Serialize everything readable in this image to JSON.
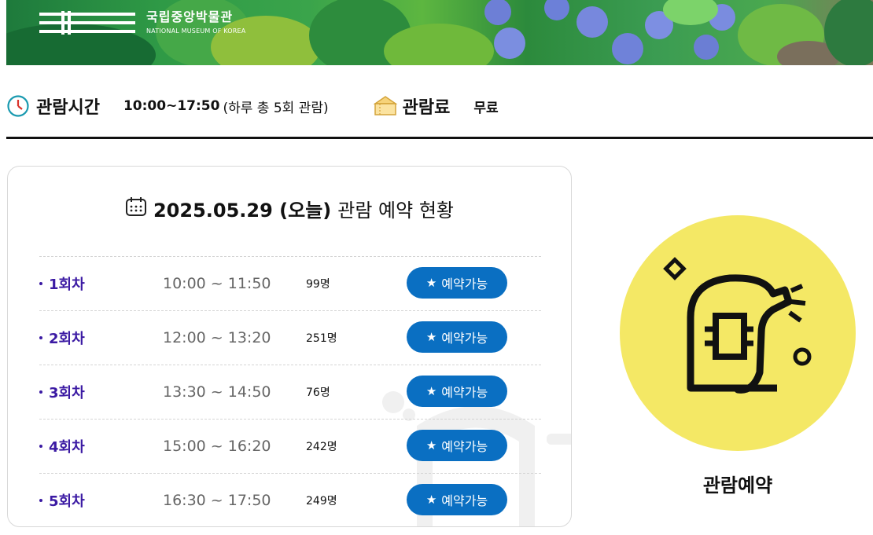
{
  "brand": {
    "name_ko": "국립중앙박물관",
    "name_en": "NATIONAL MUSEUM OF KOREA"
  },
  "info": {
    "hours_label": "관람시간",
    "hours_value": "10:00~17:50",
    "hours_note": "(하루 총 5회 관람)",
    "fee_label": "관람료",
    "fee_value": "무료",
    "hours_icon": "clock-icon",
    "fee_icon": "ticket-icon"
  },
  "status": {
    "date": "2025.05.29 (오늘)",
    "title_rest": "관람 예약 현황",
    "calendar_icon": "calendar-icon",
    "sessions": [
      {
        "label": "1회차",
        "time": "10:00 ~ 11:50",
        "count": "99명",
        "button": "예약가능"
      },
      {
        "label": "2회차",
        "time": "12:00 ~ 13:20",
        "count": "251명",
        "button": "예약가능"
      },
      {
        "label": "3회차",
        "time": "13:30 ~ 14:50",
        "count": "76명",
        "button": "예약가능"
      },
      {
        "label": "4회차",
        "time": "15:00 ~ 16:20",
        "count": "242명",
        "button": "예약가능"
      },
      {
        "label": "5회차",
        "time": "16:30 ~ 17:50",
        "count": "249명",
        "button": "예약가능"
      }
    ]
  },
  "visit": {
    "label": "관람예약",
    "icon": "shouting-character-icon"
  },
  "colors": {
    "accent_blue": "#0a6fc2",
    "session_purple": "#3b1aa3",
    "circle_yellow": "#f4e865"
  }
}
